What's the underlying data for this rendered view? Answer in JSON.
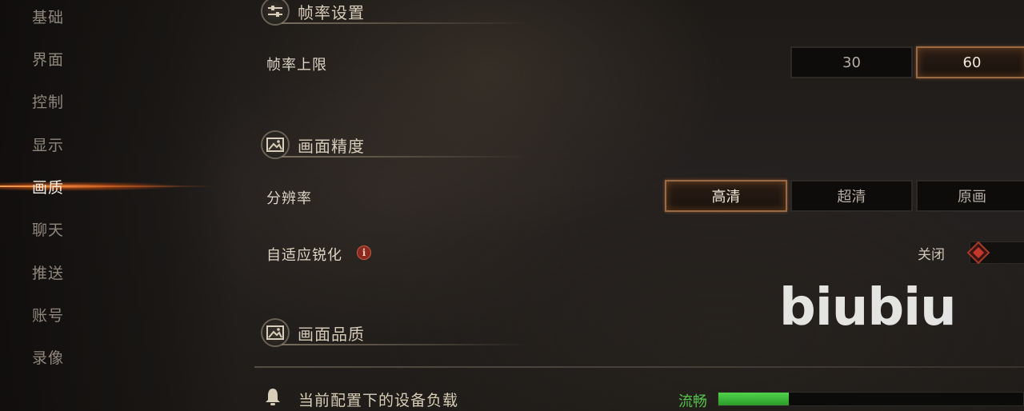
{
  "sidebar": {
    "items": [
      {
        "label": "基础",
        "active": false
      },
      {
        "label": "界面",
        "active": false
      },
      {
        "label": "控制",
        "active": false
      },
      {
        "label": "显示",
        "active": false
      },
      {
        "label": "画质",
        "active": true
      },
      {
        "label": "聊天",
        "active": false
      },
      {
        "label": "推送",
        "active": false
      },
      {
        "label": "账号",
        "active": false
      },
      {
        "label": "录像",
        "active": false
      }
    ]
  },
  "sections": {
    "framerate": {
      "title": "帧率设置",
      "icon": "sliders-icon",
      "limit_label": "帧率上限",
      "options": [
        "30",
        "60"
      ],
      "selected": "60"
    },
    "precision": {
      "title": "画面精度",
      "icon": "image-icon",
      "resolution_label": "分辨率",
      "options": [
        "高清",
        "超清",
        "原画"
      ],
      "selected": "高清",
      "sharpen_label": "自适应锐化",
      "sharpen_info": "i",
      "sharpen_value": "关闭"
    },
    "quality": {
      "title": "画面品质",
      "icon": "image-icon"
    }
  },
  "load": {
    "label": "当前配置下的设备负载",
    "status": "流畅",
    "status_color": "#56c24a",
    "level": 0.23
  },
  "watermark": "biubiu",
  "colors": {
    "accent": "#9a6a44",
    "active_glow": "#ff9a40"
  }
}
